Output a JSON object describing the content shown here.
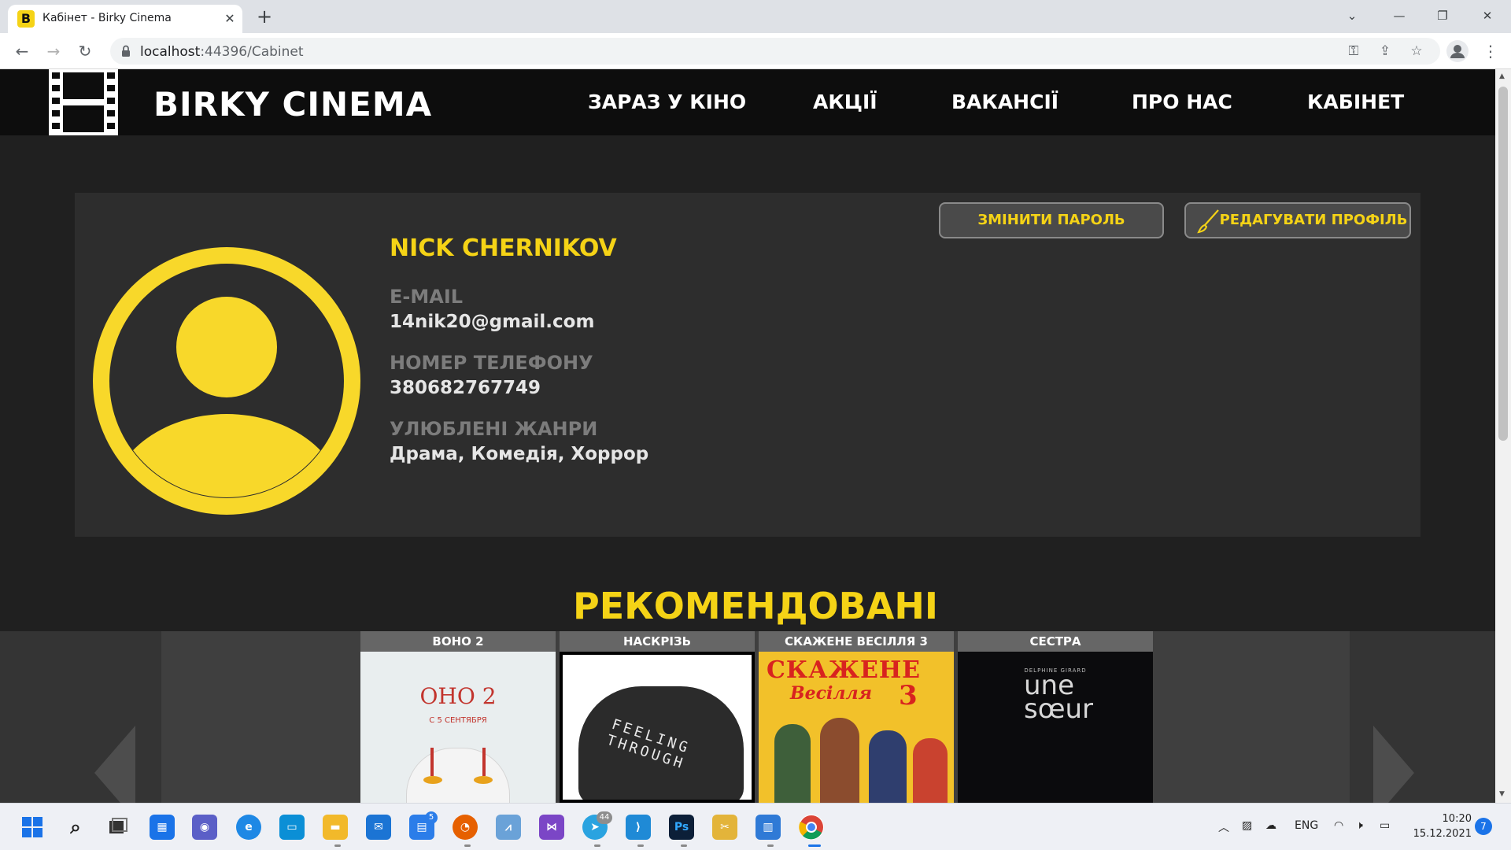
{
  "browser": {
    "tab_title": "Кабінет - Birky Cinema",
    "favicon_letter": "B",
    "url_host": "localhost",
    "url_rest": ":44396/Cabinet"
  },
  "site": {
    "name": "BIRKY CINEMA",
    "nav": [
      "ЗАРАЗ У КІНО",
      "АКЦІЇ",
      "ВАКАНСІЇ",
      "ПРО НАС",
      "КАБІНЕТ"
    ]
  },
  "profile": {
    "name": "NICK CHERNIKOV",
    "email_label": "E-MAIL",
    "email": "14nik20@gmail.com",
    "phone_label": "НОМЕР ТЕЛЕФОНУ",
    "phone": "380682767749",
    "genres_label": "УЛЮБЛЕНІ ЖАНРИ",
    "genres": "Драма, Комедія, Хоррор",
    "change_password": "ЗМІНИТИ ПАРОЛЬ",
    "edit_profile": "РЕДАГУВАТИ ПРОФІЛЬ"
  },
  "recommended": {
    "title": "РЕКОМЕНДОВАНІ",
    "movies": [
      {
        "title": "ВОНО 2",
        "poster_text": "ОНО 2",
        "poster_sub": "С 5 СЕНТЯБРЯ"
      },
      {
        "title": "НАСКРІЗЬ",
        "poster_text": "FEELING THROUGH"
      },
      {
        "title": "СКАЖЕНЕ ВЕСІЛЛЯ 3",
        "poster_text": "СКАЖЕНЕ",
        "poster_sub": "Весілля"
      },
      {
        "title": "СЕСТРА",
        "poster_text": "une sœur",
        "poster_sub": "DELPHINE GIRARD"
      }
    ]
  },
  "taskbar": {
    "lang": "ENG",
    "time": "10:20",
    "date": "15.12.2021",
    "notifications": "7",
    "badge_store": "5",
    "badge_telegram": "44"
  },
  "colors": {
    "accent": "#f5d316",
    "header_bg": "#0d0d0d",
    "card_bg": "#2d2d2d"
  }
}
